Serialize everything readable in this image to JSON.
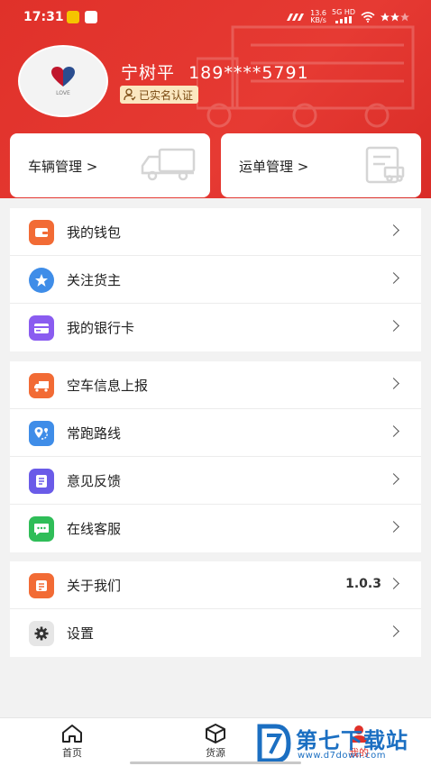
{
  "status_bar": {
    "time": "17:31",
    "network_speed": "13.6",
    "network_unit": "KB/s",
    "network_type": "5G HD"
  },
  "profile": {
    "name": "宁树平",
    "phone": "189****5791",
    "verified_label": "已实名认证",
    "avatar_caption": "LOVE"
  },
  "quick_cards": [
    {
      "label": "车辆管理 >"
    },
    {
      "label": "运单管理 >"
    }
  ],
  "menu_groups": [
    {
      "items": [
        {
          "label": "我的钱包",
          "icon": "wallet-icon",
          "color": "#f26b35"
        },
        {
          "label": "关注货主",
          "icon": "star-icon",
          "color": "#3f8de8"
        },
        {
          "label": "我的银行卡",
          "icon": "bank-card-icon",
          "color": "#8a5cf0"
        }
      ]
    },
    {
      "items": [
        {
          "label": "空车信息上报",
          "icon": "truck-icon",
          "color": "#f26b35"
        },
        {
          "label": "常跑路线",
          "icon": "route-icon",
          "color": "#3f8de8"
        },
        {
          "label": "意见反馈",
          "icon": "feedback-icon",
          "color": "#6a5be8"
        },
        {
          "label": "在线客服",
          "icon": "chat-icon",
          "color": "#2fbd58"
        }
      ]
    },
    {
      "items": [
        {
          "label": "关于我们",
          "icon": "about-icon",
          "color": "#f26b35",
          "value": "1.0.3"
        },
        {
          "label": "设置",
          "icon": "gear-icon",
          "color": "#d9d9d9"
        }
      ]
    }
  ],
  "tabbar": [
    {
      "label": "首页",
      "icon": "home-icon"
    },
    {
      "label": "货源",
      "icon": "box-icon"
    },
    {
      "label": "我的",
      "icon": "user-icon"
    }
  ],
  "watermark": {
    "title": "第七下载站",
    "url": "www.d7down.com"
  },
  "colors": {
    "brand_red": "#e0312a",
    "badge_bg": "#fbe7c0"
  }
}
